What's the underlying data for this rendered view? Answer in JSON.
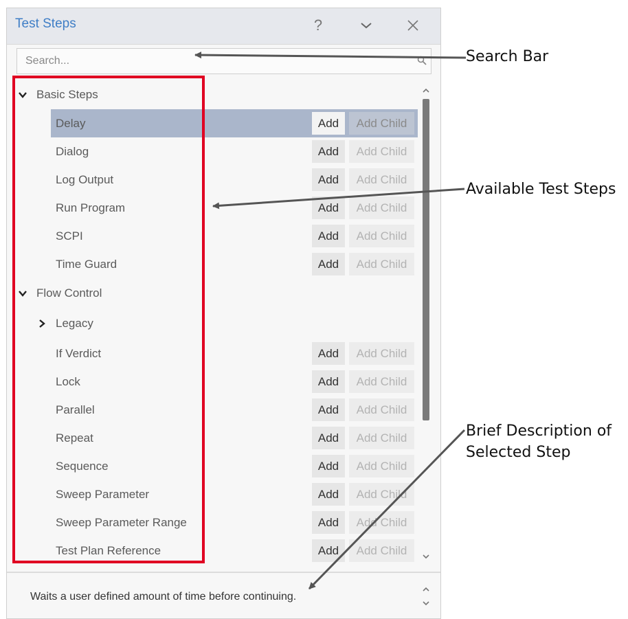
{
  "window": {
    "title": "Test Steps",
    "help_glyph": "?",
    "collapse_glyph": "⌄",
    "close_glyph": "✕"
  },
  "search": {
    "placeholder": "Search..."
  },
  "groups": [
    {
      "label": "Basic Steps",
      "expanded": true,
      "items": [
        {
          "label": "Delay",
          "selected": true,
          "add": "Add",
          "add_child": "Add Child"
        },
        {
          "label": "Dialog",
          "add": "Add",
          "add_child": "Add Child"
        },
        {
          "label": "Log Output",
          "add": "Add",
          "add_child": "Add Child"
        },
        {
          "label": "Run Program",
          "add": "Add",
          "add_child": "Add Child"
        },
        {
          "label": "SCPI",
          "add": "Add",
          "add_child": "Add Child"
        },
        {
          "label": "Time Guard",
          "add": "Add",
          "add_child": "Add Child"
        }
      ]
    },
    {
      "label": "Flow Control",
      "expanded": true,
      "subgroup": {
        "label": "Legacy",
        "expanded": false
      },
      "items": [
        {
          "label": "If Verdict",
          "add": "Add",
          "add_child": "Add Child"
        },
        {
          "label": "Lock",
          "add": "Add",
          "add_child": "Add Child"
        },
        {
          "label": "Parallel",
          "add": "Add",
          "add_child": "Add Child"
        },
        {
          "label": "Repeat",
          "add": "Add",
          "add_child": "Add Child"
        },
        {
          "label": "Sequence",
          "add": "Add",
          "add_child": "Add Child"
        },
        {
          "label": "Sweep Parameter",
          "add": "Add",
          "add_child": "Add Child"
        },
        {
          "label": "Sweep Parameter Range",
          "add": "Add",
          "add_child": "Add Child"
        },
        {
          "label": "Test Plan Reference",
          "add": "Add",
          "add_child": "Add Child"
        }
      ]
    }
  ],
  "description": "Waits a user defined amount of time before continuing.",
  "annotations": {
    "search_bar": "Search Bar",
    "available_steps": "Available Test Steps",
    "brief_description_line1": "Brief Description of",
    "brief_description_line2": "Selected Step"
  },
  "colors": {
    "title": "#3f7ec6",
    "selection": "#aab6cb",
    "highlight_box": "#e00022",
    "arrow": "#555555"
  }
}
